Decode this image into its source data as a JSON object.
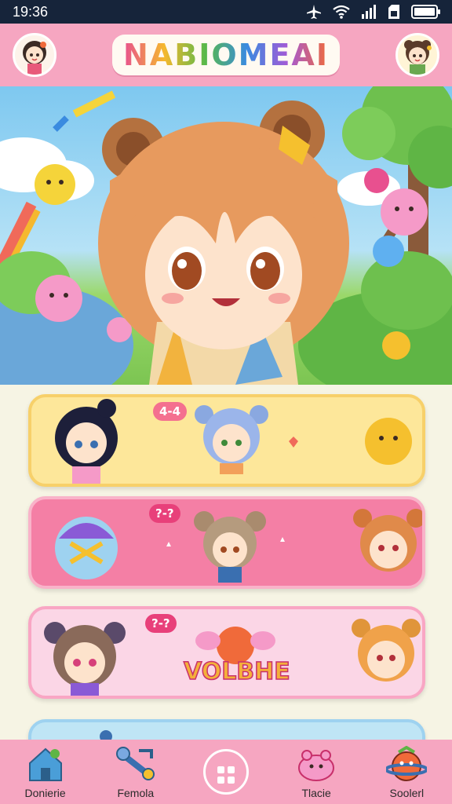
{
  "status_bar": {
    "time": "19:36"
  },
  "header": {
    "title": "NABIOMEAI"
  },
  "cards": [
    {
      "badge": "4-4",
      "title": ""
    },
    {
      "badge": "?-?",
      "title": ""
    },
    {
      "badge": "?-?",
      "title": "VOLBHE"
    },
    {
      "badge": "",
      "title": ""
    }
  ],
  "bottom_nav": {
    "items": [
      {
        "label": "Donierie",
        "icon": "house-icon"
      },
      {
        "label": "Femola",
        "icon": "wrench-icon"
      },
      {
        "label": "",
        "icon": "grid-icon"
      },
      {
        "label": "Tlacie",
        "icon": "creature-icon"
      },
      {
        "label": "Soolerl",
        "icon": "planet-creature-icon"
      }
    ]
  },
  "colors": {
    "status_bar": "#16243a",
    "header": "#f6a6c1",
    "card_yellow": "#fde79a",
    "card_pink": "#f47fa5",
    "card_light_pink": "#fbd6e6",
    "card_blue": "#bfe5f5"
  }
}
